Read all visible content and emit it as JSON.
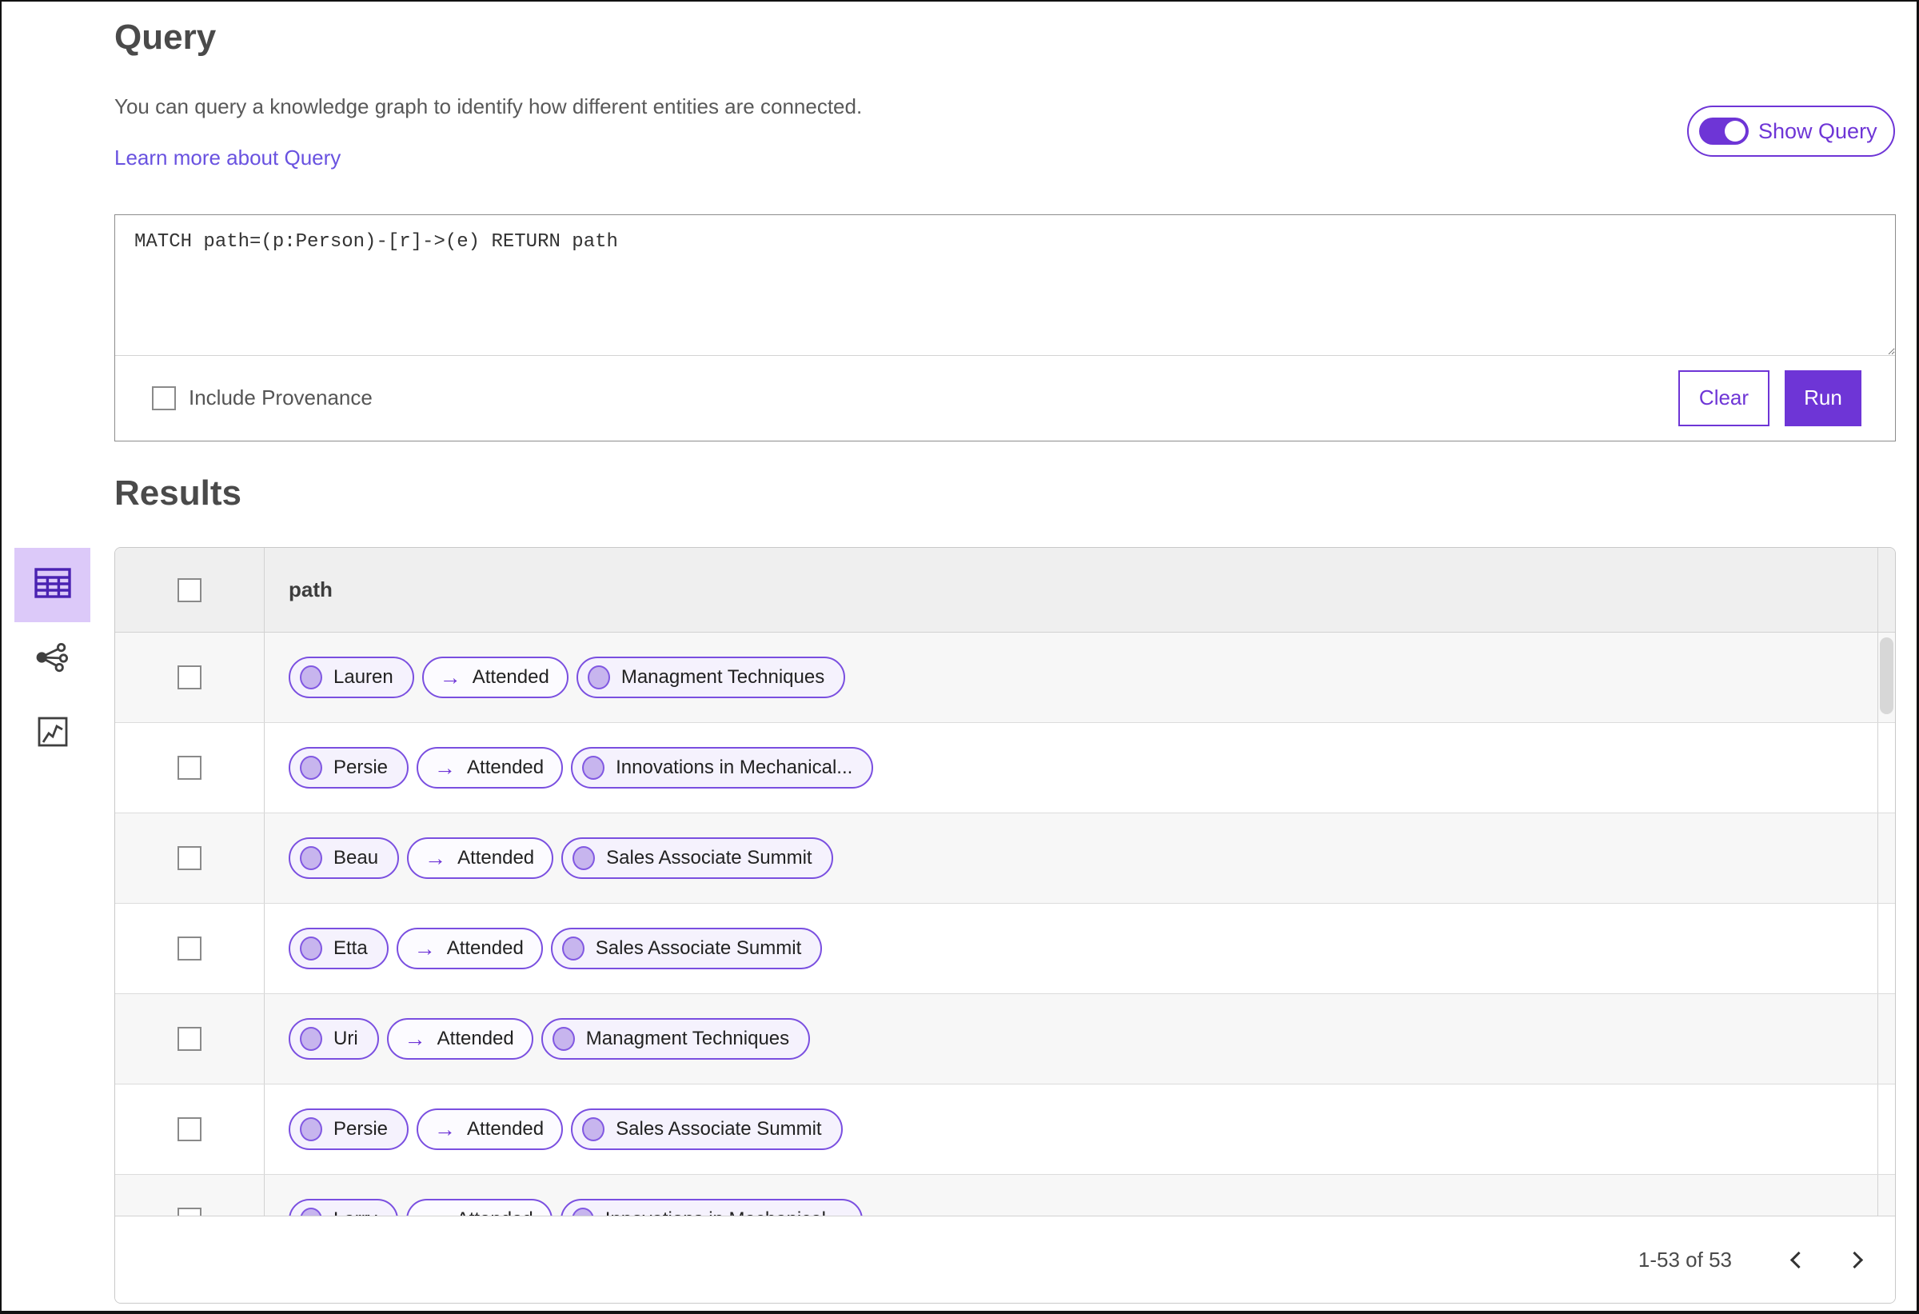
{
  "colors": {
    "accent": "#6e35d6",
    "pill_border": "#7a4fe0",
    "node_circle_fill": "#c7b5ee",
    "selected_view_bg": "#dcc9f9",
    "link": "#6952e0"
  },
  "header": {
    "title": "Query",
    "description": "You can query a knowledge graph to identify how different entities are connected.",
    "learn_more_link": "Learn more about Query",
    "show_query_toggle": {
      "label": "Show Query",
      "state": "on"
    }
  },
  "query_panel": {
    "editor_text": "MATCH path=(p:Person)-[r]->(e) RETURN path",
    "include_provenance": {
      "label": "Include Provenance",
      "checked": false
    },
    "clear_button": "Clear",
    "run_button": "Run"
  },
  "results": {
    "title": "Results",
    "view_switcher": [
      {
        "name": "table-view",
        "selected": true
      },
      {
        "name": "network-view",
        "selected": false
      },
      {
        "name": "chart-view",
        "selected": false
      }
    ],
    "table": {
      "columns": [
        "path"
      ],
      "edge_arrow_glyph": "→",
      "rows": [
        {
          "source": "Lauren",
          "edge": "Attended",
          "target": "Managment Techniques"
        },
        {
          "source": "Persie",
          "edge": "Attended",
          "target": "Innovations in Mechanical..."
        },
        {
          "source": "Beau",
          "edge": "Attended",
          "target": "Sales Associate Summit"
        },
        {
          "source": "Etta",
          "edge": "Attended",
          "target": "Sales Associate Summit"
        },
        {
          "source": "Uri",
          "edge": "Attended",
          "target": "Managment Techniques"
        },
        {
          "source": "Persie",
          "edge": "Attended",
          "target": "Sales Associate Summit"
        },
        {
          "source": "Larry",
          "edge": "Attended",
          "target": "Innovations in Mechanical..."
        }
      ]
    },
    "pagination": {
      "range_label": "1-53 of 53"
    }
  }
}
